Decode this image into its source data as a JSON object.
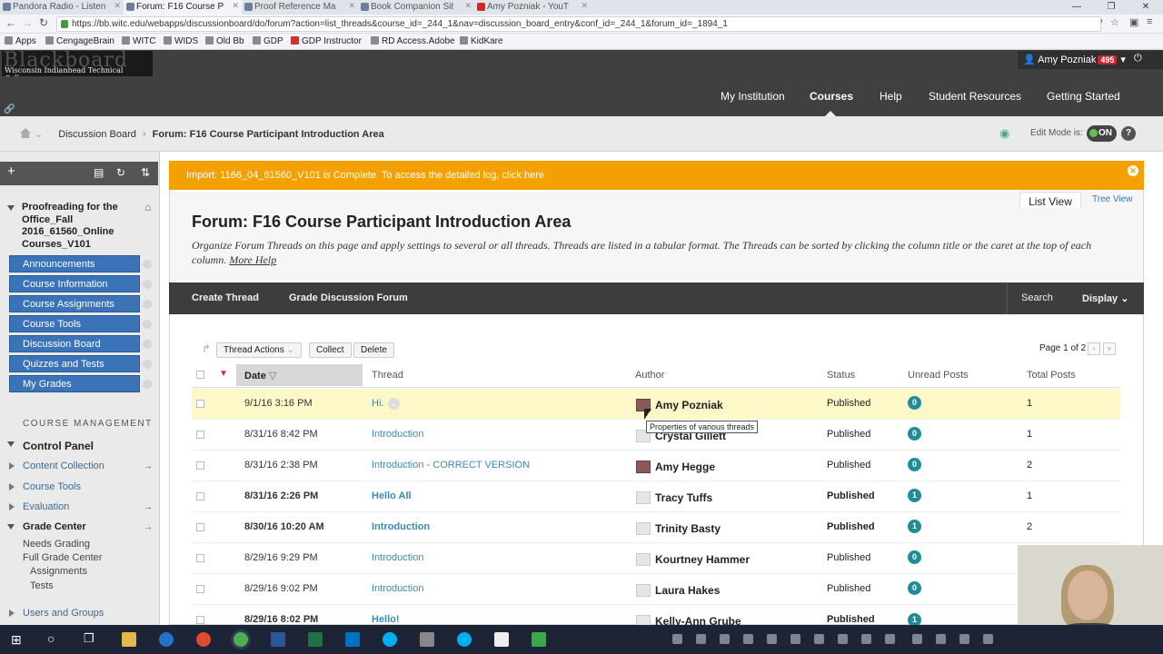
{
  "browser": {
    "tabs": [
      {
        "label": "Pandora Radio - Listen"
      },
      {
        "label": "Forum: F16 Course P"
      },
      {
        "label": "Proof Reference Ma"
      },
      {
        "label": "Book Companion Sit"
      },
      {
        "label": "Amy Pozniak - YouT"
      }
    ],
    "url": "https://bb.witc.edu/webapps/discussionboard/do/forum?action=list_threads&course_id=_244_1&nav=discussion_board_entry&conf_id=_244_1&forum_id=_1894_1",
    "bookmarks": [
      "Apps",
      "CengageBrain",
      "WITC",
      "WIDS",
      "Old Bb",
      "GDP",
      "GDP Instructor",
      "RD Access.Adobe",
      "KidKare"
    ]
  },
  "header": {
    "logo_text": "Blackboard",
    "logo_subtext": "Wisconsin Indianhead Technical College",
    "user_name": "Amy Pozniak",
    "notification_count": "495",
    "nav": [
      "My Institution",
      "Courses",
      "Help",
      "Student Resources",
      "Getting Started"
    ],
    "selected_nav": "Courses"
  },
  "breadcrumb": {
    "items": [
      "Discussion Board",
      "Forum: F16 Course Participant Introduction Area"
    ],
    "edit_mode_label": "Edit Mode is:",
    "edit_mode_value": "ON"
  },
  "sidebar": {
    "course_title": "Proofreading for the Office_Fall 2016_61560_Online Courses_V101",
    "menu": [
      "Announcements",
      "Course Information",
      "Course Assignments",
      "Course Tools",
      "Discussion Board",
      "Quizzes and Tests",
      "My Grades"
    ],
    "management_heading": "COURSE MANAGEMENT",
    "control_panel": "Control Panel",
    "cp_items": [
      "Content Collection",
      "Course Tools",
      "Evaluation",
      "Grade Center"
    ],
    "grade_center_sub": [
      "Needs Grading",
      "Full Grade Center",
      "Assignments",
      "Tests"
    ],
    "users_groups": "Users and Groups"
  },
  "receipt": {
    "message": "Import: 1166_04_61560_V101 is Complete. To access the detailed log, click here"
  },
  "views": {
    "list": "List View",
    "tree": "Tree View"
  },
  "forum": {
    "title": "Forum: F16 Course Participant Introduction Area",
    "description": "Organize Forum Threads on this page and apply settings to several or all threads. Threads are listed in a tabular format. The Threads can be sorted by clicking the column title or the caret at the top of each column.",
    "more_help": "More Help"
  },
  "actionbar": {
    "create_thread": "Create Thread",
    "grade_forum": "Grade Discussion Forum",
    "search": "Search",
    "display": "Display"
  },
  "table": {
    "thread_actions": "Thread Actions",
    "collect": "Collect",
    "delete": "Delete",
    "pager": "Page 1 of 2",
    "headers": {
      "date": "Date",
      "thread": "Thread",
      "author": "Author",
      "status": "Status",
      "unread": "Unread Posts",
      "total": "Total Posts"
    },
    "rows": [
      {
        "date": "9/1/16 3:16 PM",
        "thread": "Hi.",
        "author": "Amy Pozniak",
        "status": "Published",
        "unread": "0",
        "total": "1"
      },
      {
        "date": "8/31/16 8:42 PM",
        "thread": "Introduction",
        "author": "Crystal Gillett",
        "status": "Published",
        "unread": "0",
        "total": "1"
      },
      {
        "date": "8/31/16 2:38 PM",
        "thread": "Introduction - CORRECT VERSION",
        "author": "Amy Hegge",
        "status": "Published",
        "unread": "0",
        "total": "2"
      },
      {
        "date": "8/31/16 2:26 PM",
        "thread": "Hello All",
        "author": "Tracy Tuffs",
        "status": "Published",
        "unread": "1",
        "total": "1"
      },
      {
        "date": "8/30/16 10:20 AM",
        "thread": "Introduction",
        "author": "Trinity Basty",
        "status": "Published",
        "unread": "1",
        "total": "2"
      },
      {
        "date": "8/29/16 9:29 PM",
        "thread": "Introduction",
        "author": "Kourtney Hammer",
        "status": "Published",
        "unread": "0",
        "total": ""
      },
      {
        "date": "8/29/16 9:02 PM",
        "thread": "Introduction",
        "author": "Laura Hakes",
        "status": "Published",
        "unread": "0",
        "total": ""
      },
      {
        "date": "8/29/16 8:02 PM",
        "thread": "Hello!",
        "author": "Kelly-Ann Grube",
        "status": "Published",
        "unread": "1",
        "total": ""
      }
    ],
    "tooltip": "Properties of various threads"
  }
}
